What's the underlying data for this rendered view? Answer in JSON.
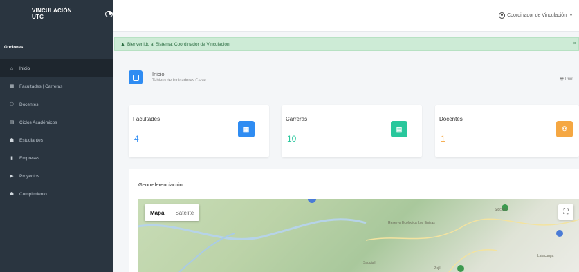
{
  "sidebar": {
    "brand": "VINCULACIÓN UTC",
    "section_label": "Opciones",
    "items": [
      {
        "label": "Inicio",
        "icon": "home-icon",
        "glyph": "⌂",
        "active": true
      },
      {
        "label": "Facultades | Carreras",
        "icon": "building-icon",
        "glyph": "▦",
        "active": false
      },
      {
        "label": "Docentes",
        "icon": "users-icon",
        "glyph": "⚇",
        "active": false
      },
      {
        "label": "Ciclos Académicos",
        "icon": "calendar-icon",
        "glyph": "▤",
        "active": false
      },
      {
        "label": "Estudiantes",
        "icon": "students-icon",
        "glyph": "☗",
        "active": false
      },
      {
        "label": "Empresas",
        "icon": "briefcase-icon",
        "glyph": "▮",
        "active": false
      },
      {
        "label": "Proyectos",
        "icon": "folder-icon",
        "glyph": "▶",
        "active": false
      },
      {
        "label": "Cumplimiento",
        "icon": "check-icon",
        "glyph": "☗",
        "active": false
      }
    ]
  },
  "topbar": {
    "user_label": "Coordinador de Vinculación"
  },
  "alert": {
    "text": "Bienvenido al Sistema: Coordinador de Vinculación",
    "close": "×"
  },
  "header": {
    "title": "Inicio",
    "subtitle": "Tablero de Indicadores Clave",
    "print": "Print"
  },
  "cards": [
    {
      "label": "Facultades",
      "value": "4",
      "color": "#2f8cf2",
      "icon": "building-icon",
      "glyph": "▦"
    },
    {
      "label": "Carreras",
      "value": "10",
      "color": "#28c79c",
      "icon": "book-icon",
      "glyph": "▤"
    },
    {
      "label": "Docentes",
      "value": "1",
      "color": "#f5a742",
      "icon": "user-icon",
      "glyph": "⚇"
    }
  ],
  "geo": {
    "title": "Georreferenciación",
    "map_tab": "Mapa",
    "satellite_tab": "Satélite",
    "fullscreen": "⛶",
    "labels": [
      "Reserva Ecológica Los Ilinizas",
      "Sigchos",
      "Saquisilí",
      "Pujilí",
      "Latacunga"
    ]
  }
}
